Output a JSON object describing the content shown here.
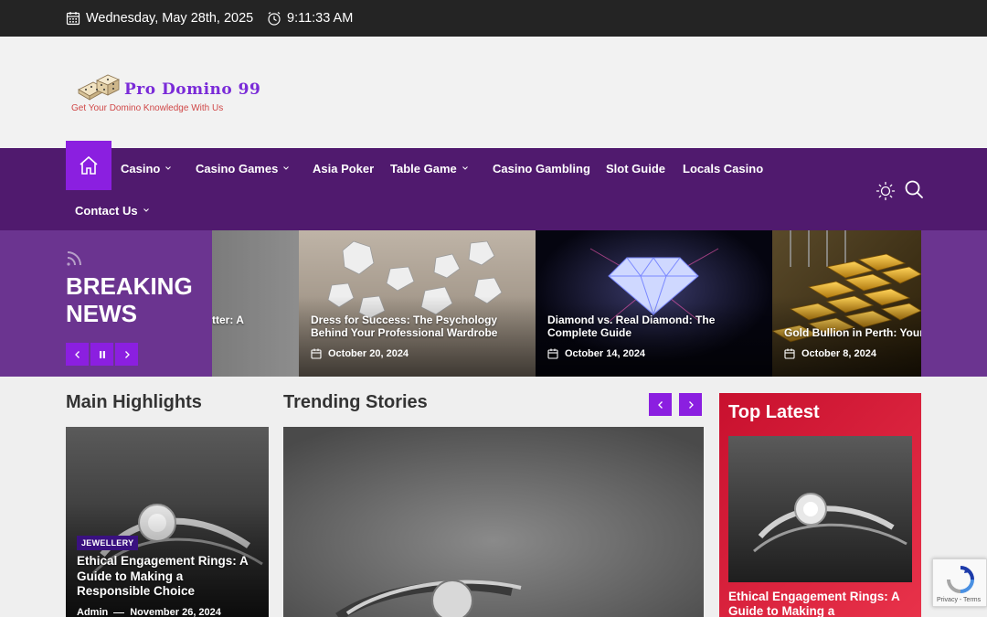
{
  "topbar": {
    "date": "Wednesday, May 28th, 2025",
    "time": "9:11:33 AM"
  },
  "logo": {
    "name": "Pro Domino 99",
    "tagline": "Get Your Domino Knowledge With Us"
  },
  "nav": {
    "items": [
      {
        "label": "Casino",
        "has_dropdown": true
      },
      {
        "label": "Casino Games",
        "has_dropdown": true
      },
      {
        "label": "Asia Poker",
        "has_dropdown": false
      },
      {
        "label": "Table Game",
        "has_dropdown": true
      },
      {
        "label": "Casino Gambling",
        "has_dropdown": false
      },
      {
        "label": "Slot Guide",
        "has_dropdown": false
      },
      {
        "label": "Locals Casino",
        "has_dropdown": false
      },
      {
        "label": "Contact Us",
        "has_dropdown": true
      }
    ]
  },
  "breaking": {
    "title": "BREAKING NEWS",
    "slides": [
      {
        "title": "tter: A",
        "date": ""
      },
      {
        "title": "Dress for Success: The Psychology Behind Your Professional Wardrobe",
        "date": "October 20, 2024"
      },
      {
        "title": "Diamond vs. Real Diamond: The Complete Guide",
        "date": "October 14, 2024"
      },
      {
        "title": "Gold Bullion in Perth: Your U",
        "date": "October 8, 2024"
      }
    ]
  },
  "main_highlights": {
    "heading": "Main Highlights",
    "post": {
      "category": "JEWELLERY",
      "title": "Ethical Engagement Rings: A Guide to Making a Responsible Choice",
      "author": "Admin",
      "date": "November 26, 2024"
    }
  },
  "trending": {
    "heading": "Trending Stories"
  },
  "top_latest": {
    "heading": "Top Latest",
    "post_title": "Ethical Engagement Rings: A Guide to Making a Responsible"
  },
  "recaptcha": {
    "links": "Privacy - Terms"
  },
  "colors": {
    "topbar": "#242424",
    "nav": "#501a6e",
    "accent": "#8b1fe0",
    "breaking": "#6b3490",
    "top_latest": "#d81f3a"
  },
  "icons": [
    "calendar-icon",
    "clock-icon",
    "home-icon",
    "chevron-down-icon",
    "sun-icon",
    "search-icon",
    "rss-icon",
    "chevron-left-icon",
    "pause-icon",
    "chevron-right-icon",
    "recaptcha-icon"
  ]
}
